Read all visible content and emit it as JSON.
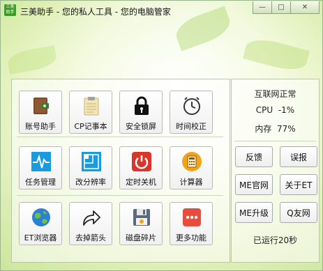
{
  "window": {
    "title": "三美助手 - 您的私人工具 - 您的电脑管家",
    "app_icon_text": "三美助手",
    "buttons": {
      "minimize": "—",
      "maximize": "□",
      "close": "✕"
    }
  },
  "tools": [
    {
      "label": "账号助手",
      "icon": "wallet-icon"
    },
    {
      "label": "CP记事本",
      "icon": "clipboard-icon"
    },
    {
      "label": "安全锁屏",
      "icon": "lock-icon"
    },
    {
      "label": "时间校正",
      "icon": "clock-icon"
    },
    {
      "label": "任务管理",
      "icon": "pulse-monitor-icon"
    },
    {
      "label": "改分辨率",
      "icon": "resolution-icon"
    },
    {
      "label": "定时关机",
      "icon": "power-icon"
    },
    {
      "label": "计算器",
      "icon": "calculator-icon"
    },
    {
      "label": "ET浏览器",
      "icon": "globe-icon"
    },
    {
      "label": "去掉箭头",
      "icon": "share-arrow-icon"
    },
    {
      "label": "磁盘碎片",
      "icon": "floppy-disk-icon"
    },
    {
      "label": "更多功能",
      "icon": "more-icon"
    }
  ],
  "status": {
    "internet": "互联网正常",
    "cpu_label": "CPU",
    "cpu_value": "-1%",
    "mem_label": "内存",
    "mem_value": "77%"
  },
  "side_buttons": {
    "feedback": "反馈",
    "report": "误报",
    "me_site": "ME官网",
    "about_et": "关于ET",
    "me_upgrade": "ME升级",
    "q_friends": "Q友网"
  },
  "uptime": "已运行20秒",
  "colors": {
    "background_green": "#d6ecae",
    "lock_black": "#111111",
    "power_red": "#d9362b",
    "task_blue": "#1a9be0",
    "calc_orange": "#f2a316",
    "more_red": "#e84c3d"
  }
}
